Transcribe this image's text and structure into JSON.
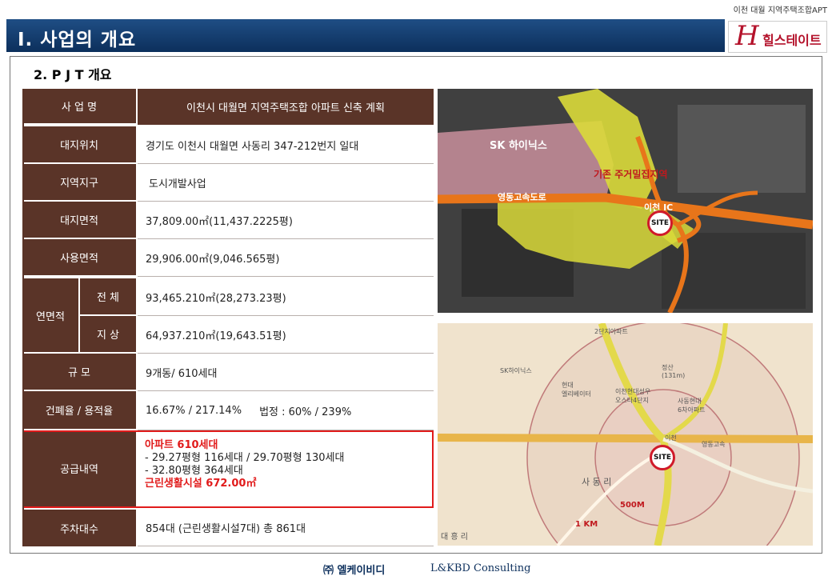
{
  "doc": {
    "subtitle": "이천 대월 지역주택조합APT",
    "header_title": "Ⅰ. 사업의 개요",
    "brand": {
      "mark": "H",
      "name": "힐스테이트",
      "color": "#b4122b"
    },
    "section_title": "2. P J T  개요"
  },
  "table": {
    "project_name": {
      "label": "사 업 명",
      "value": "이천시 대월면 지역주택조합 아파트 신축 계획"
    },
    "rows": [
      {
        "label": "대지위치",
        "value": "경기도 이천시 대월면 사동리 347-212번지 일대"
      },
      {
        "label": "지역지구",
        "value": "도시개발사업"
      },
      {
        "label": "대지면적",
        "value": "37,809.00㎡(11,437.2225평)"
      },
      {
        "label": "사용면적",
        "value": "29,906.00㎡(9,046.565평)"
      }
    ],
    "floor_area": {
      "label": "연면적",
      "total": {
        "label": "전 체",
        "value": "93,465.210㎡(28,273.23평)"
      },
      "above": {
        "label": "지 상",
        "value": "64,937.210㎡(19,643.51평)"
      }
    },
    "scale": {
      "label": "규 모",
      "value": "9개동/ 610세대"
    },
    "ratio": {
      "label": "건폐율 / 용적율",
      "value": "16.67% / 217.14%",
      "legal": "법정 : 60% / 239%"
    },
    "supply": {
      "label": "공급내역",
      "line1": "아파트 610세대",
      "line2": "-   29.27평형  116세대  / 29.70평형  130세대",
      "line3": "-   32.80평형  364세대",
      "line4": "근린생활시설 672.00㎡"
    },
    "parking": {
      "label": "주차대수",
      "value": "854대  (근린생활시설7대) 총 861대"
    }
  },
  "map_aerial": {
    "labels": {
      "sk": "SK 하이닉스",
      "residential": "기존 주거밀집지역",
      "expressway": "영동고속도로",
      "ic": "이천 IC",
      "site": "SITE"
    },
    "colors": {
      "pink_zone": "#c98f9c",
      "yellow_zone": "#dada3a",
      "road": "#e8751a"
    }
  },
  "map_street": {
    "labels": {
      "apt_2": "2단지아파트",
      "sk": "SK하이닉스",
      "hyundai": "현대\n엘리베이터",
      "castle": "이천현대성우\n오스타4단지",
      "jeongsan": "정산\n(131m)",
      "sadong_hyundai": "사동현대\n6차아파트",
      "expressway": "영동고속",
      "icheon": "이천",
      "site": "SITE",
      "sadongri": "사 동 리",
      "daeheungri": "대 흥 리",
      "r500": "500M",
      "r1km": "1 KM"
    }
  },
  "footer": {
    "company_ko": "㈜ 엘케이비디",
    "company_en": "L&KBD  Consulting"
  }
}
